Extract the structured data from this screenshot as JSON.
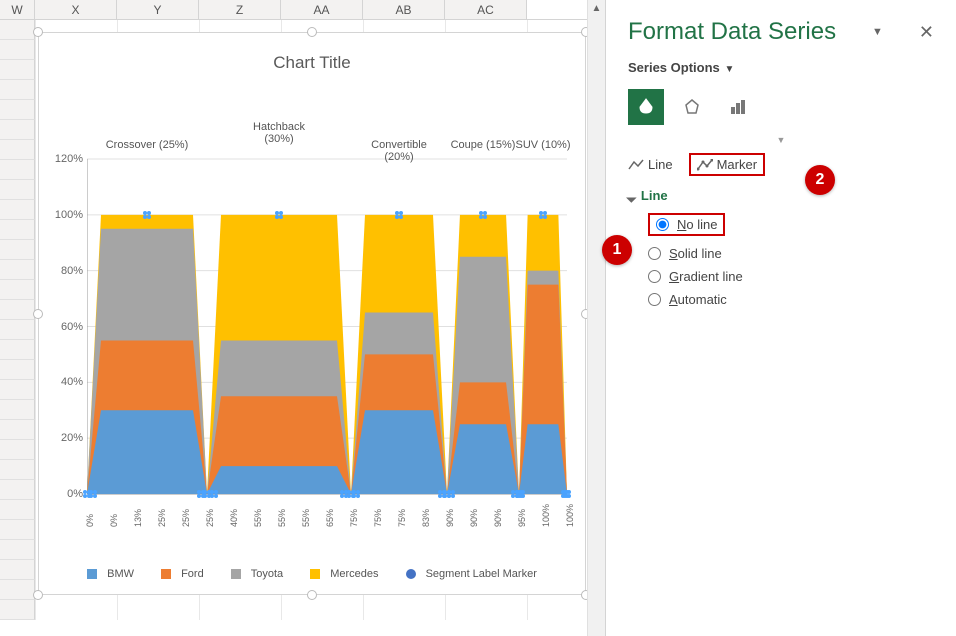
{
  "colHeaders": [
    "W",
    "X",
    "Y",
    "Z",
    "AA",
    "AB",
    "AC"
  ],
  "chart": {
    "title": "Chart Title",
    "yAxis": {
      "ticks": [
        0,
        20,
        40,
        60,
        80,
        100,
        120
      ],
      "unit": "%"
    },
    "legend": [
      "BMW",
      "Ford",
      "Toyota",
      "Mercedes",
      "Segment Label Marker"
    ],
    "colors": {
      "BMW": "#5b9bd5",
      "Ford": "#ed7d31",
      "Toyota": "#a5a5a5",
      "Mercedes": "#ffc000",
      "Marker": "#4472c4"
    },
    "segments": [
      {
        "label": "Crossover (25%)",
        "start": 0,
        "end": 25,
        "stacks": {
          "BMW": 30,
          "Ford": 25,
          "Toyota": 40,
          "Mercedes": 5
        }
      },
      {
        "label": "Hatchback (30%)",
        "start": 25,
        "end": 55,
        "stacks": {
          "BMW": 10,
          "Ford": 25,
          "Toyota": 20,
          "Mercedes": 45
        }
      },
      {
        "label": "Convertible (20%)",
        "start": 55,
        "end": 75,
        "stacks": {
          "BMW": 30,
          "Ford": 20,
          "Toyota": 15,
          "Mercedes": 35
        }
      },
      {
        "label": "Coupe (15%)",
        "start": 75,
        "end": 90,
        "stacks": {
          "BMW": 25,
          "Ford": 15,
          "Toyota": 45,
          "Mercedes": 15
        }
      },
      {
        "label": "SUV (10%)",
        "start": 90,
        "end": 100,
        "stacks": {
          "BMW": 25,
          "Ford": 50,
          "Toyota": 5,
          "Mercedes": 20
        }
      }
    ],
    "xTicks": [
      "0%",
      "0%",
      "13%",
      "25%",
      "25%",
      "25%",
      "40%",
      "55%",
      "55%",
      "55%",
      "65%",
      "75%",
      "75%",
      "75%",
      "83%",
      "90%",
      "90%",
      "90%",
      "95%",
      "100%",
      "100%"
    ]
  },
  "chart_data": {
    "type": "area",
    "title": "Chart Title",
    "ylabel": "%",
    "ylim": [
      0,
      120
    ],
    "series": [
      {
        "name": "BMW",
        "values": [
          30,
          10,
          30,
          25,
          25
        ]
      },
      {
        "name": "Ford",
        "values": [
          25,
          25,
          20,
          15,
          50
        ]
      },
      {
        "name": "Toyota",
        "values": [
          40,
          20,
          15,
          45,
          5
        ]
      },
      {
        "name": "Mercedes",
        "values": [
          5,
          45,
          35,
          15,
          20
        ]
      }
    ],
    "categories": [
      "Crossover (25%)",
      "Hatchback (30%)",
      "Convertible (20%)",
      "Coupe (15%)",
      "SUV (10%)"
    ],
    "segment_widths_pct": [
      25,
      30,
      20,
      15,
      10
    ],
    "x_ticks_pct": [
      0,
      0,
      13,
      25,
      25,
      25,
      40,
      55,
      55,
      55,
      65,
      75,
      75,
      75,
      83,
      90,
      90,
      90,
      95,
      100,
      100
    ]
  },
  "formatPane": {
    "title": "Format Data Series",
    "subTitle": "Series Options",
    "tabs": {
      "line": "Line",
      "marker": "Marker"
    },
    "section": "Line",
    "radios": {
      "noLine": "No line",
      "solid": "Solid line",
      "gradient": "Gradient line",
      "auto": "Automatic"
    },
    "callouts": {
      "noLine": "1",
      "marker": "2"
    }
  }
}
